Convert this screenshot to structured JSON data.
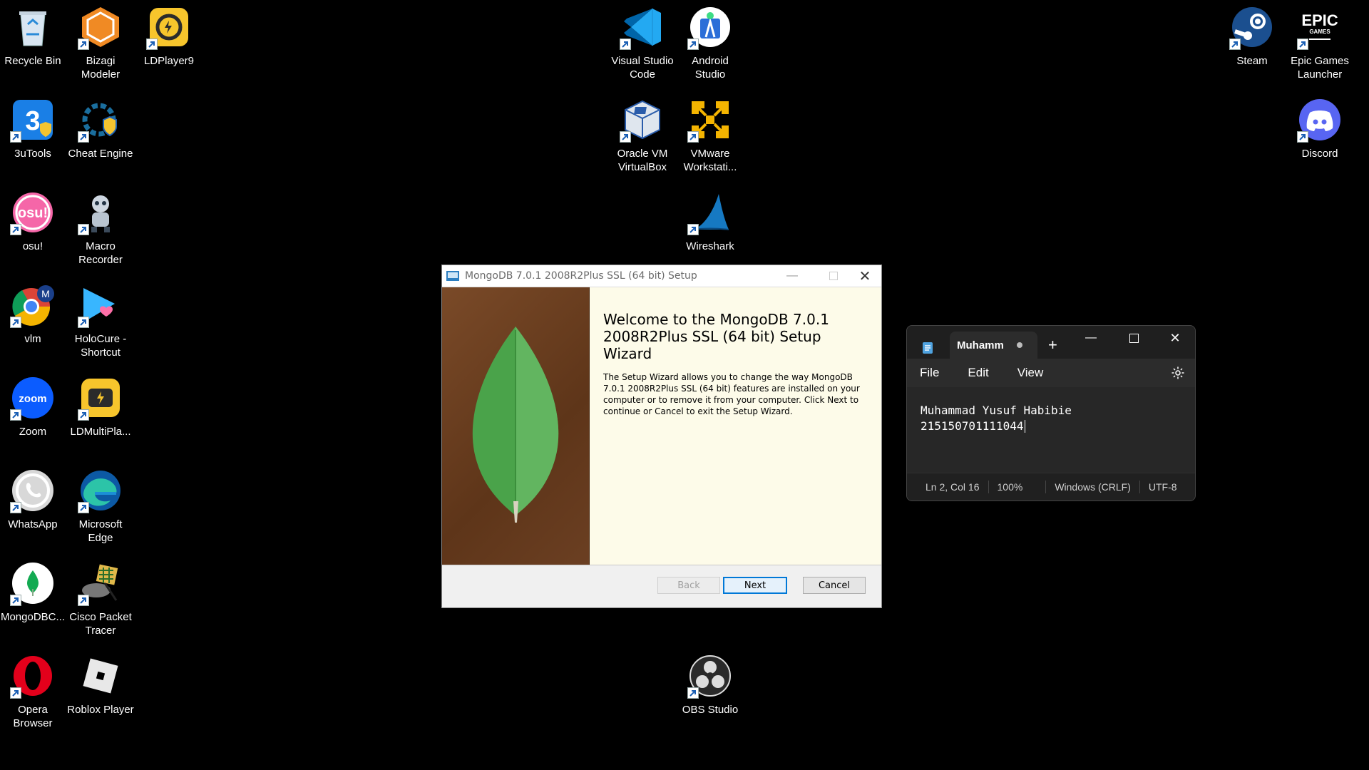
{
  "desktop_icons": [
    {
      "label": "Recycle Bin",
      "icon": "recycle-bin-icon"
    },
    {
      "label": "Bizagi\nModeler",
      "icon": "bizagi-icon"
    },
    {
      "label": "LDPlayer9",
      "icon": "ldplayer-icon"
    },
    {
      "label": "3uTools",
      "icon": "3utools-icon"
    },
    {
      "label": "Cheat Engine",
      "icon": "cheat-engine-icon"
    },
    {
      "label": "osu!",
      "icon": "osu-icon"
    },
    {
      "label": "Macro\nRecorder",
      "icon": "macro-recorder-icon"
    },
    {
      "label": "vlm",
      "icon": "chrome-icon"
    },
    {
      "label": "HoloCure -\nShortcut",
      "icon": "holocure-icon"
    },
    {
      "label": "Zoom",
      "icon": "zoom-icon"
    },
    {
      "label": "LDMultiPla...",
      "icon": "ldmultiplayer-icon"
    },
    {
      "label": "WhatsApp",
      "icon": "whatsapp-icon"
    },
    {
      "label": "Microsoft\nEdge",
      "icon": "edge-icon"
    },
    {
      "label": "MongoDBC...",
      "icon": "mongodb-compass-icon"
    },
    {
      "label": "Cisco Packet\nTracer",
      "icon": "packet-tracer-icon"
    },
    {
      "label": "Opera\nBrowser",
      "icon": "opera-icon"
    },
    {
      "label": "Roblox Player",
      "icon": "roblox-icon"
    },
    {
      "label": "Visual Studio\nCode",
      "icon": "vscode-icon"
    },
    {
      "label": "Android\nStudio",
      "icon": "android-studio-icon"
    },
    {
      "label": "Oracle VM\nVirtualBox",
      "icon": "virtualbox-icon"
    },
    {
      "label": "VMware\nWorkstati...",
      "icon": "vmware-icon"
    },
    {
      "label": "Wireshark",
      "icon": "wireshark-icon"
    },
    {
      "label": "OBS Studio",
      "icon": "obs-icon"
    },
    {
      "label": "Steam",
      "icon": "steam-icon"
    },
    {
      "label": "Epic Games\nLauncher",
      "icon": "epic-games-icon"
    },
    {
      "label": "Discord",
      "icon": "discord-icon"
    }
  ],
  "epic_logo_text": "EPIC",
  "epic_logo_sub": "GAMES",
  "setup": {
    "title": "MongoDB 7.0.1 2008R2Plus SSL (64 bit) Setup",
    "heading": "Welcome to the MongoDB 7.0.1 2008R2Plus SSL (64 bit) Setup Wizard",
    "description": "The Setup Wizard allows you to change the way MongoDB 7.0.1 2008R2Plus SSL (64 bit) features are installed on your computer or to remove it from your computer. Click Next to continue or Cancel to exit the Setup Wizard.",
    "back": "Back",
    "next": "Next",
    "cancel": "Cancel"
  },
  "notepad": {
    "tab_title": "Muhamm",
    "menu": [
      "File",
      "Edit",
      "View"
    ],
    "line1": "Muhammad Yusuf Habibie",
    "line2": "215150701111044",
    "status": {
      "position": "Ln 2, Col 16",
      "zoom": "100%",
      "line_ending": "Windows (CRLF)",
      "encoding": "UTF-8"
    }
  }
}
